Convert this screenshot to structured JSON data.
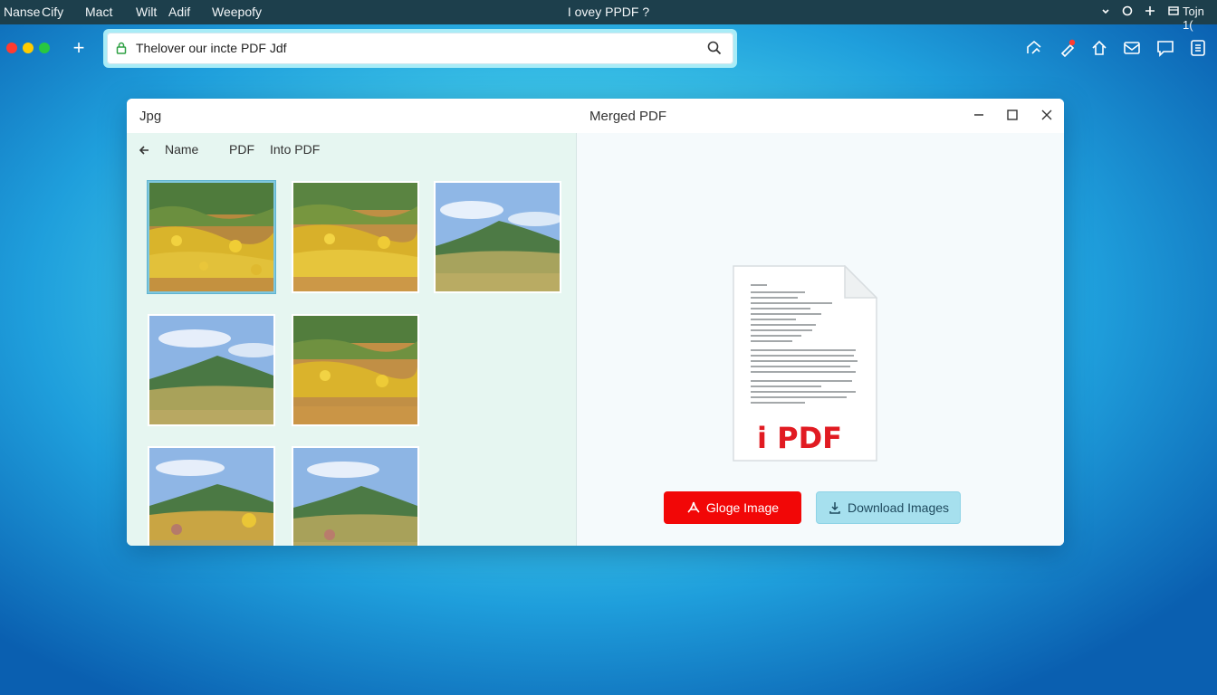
{
  "menubar": {
    "items": [
      "Nanse",
      "Cify",
      "Mact",
      "Wilt",
      "Adif",
      "Weepofy"
    ],
    "title": "I ovey PPDF ?",
    "right_text": "Tojn 1("
  },
  "browser": {
    "url": "Thelover our incte PDF Jdf",
    "traffic_colors": [
      "#ff3b30",
      "#ffcc00",
      "#28c840"
    ]
  },
  "left_pane": {
    "title": "Jpg",
    "header": {
      "col_name": "Name",
      "col_pdf": "PDF",
      "col_into": "Into PDF"
    },
    "thumbnails": [
      {
        "name": "thumb-1",
        "kind": "flowers",
        "selected": true
      },
      {
        "name": "thumb-2",
        "kind": "flowers",
        "selected": false
      },
      {
        "name": "thumb-3",
        "kind": "hill",
        "selected": false
      },
      {
        "name": "thumb-4",
        "kind": "hill",
        "selected": false
      },
      {
        "name": "thumb-5",
        "kind": "flowers",
        "selected": false
      },
      {
        "name": "thumb-6",
        "kind": "hill-flowers",
        "selected": false
      },
      {
        "name": "thumb-7",
        "kind": "hill",
        "selected": false
      }
    ]
  },
  "right_pane": {
    "title": "Merged PDF",
    "pdf_label": "i PDF",
    "primary_button": "Gloge Image",
    "secondary_button": "Download Images"
  },
  "colors": {
    "primary_red": "#f20707",
    "secondary_blue": "#a6e0ee",
    "pdf_red": "#e11b22"
  }
}
